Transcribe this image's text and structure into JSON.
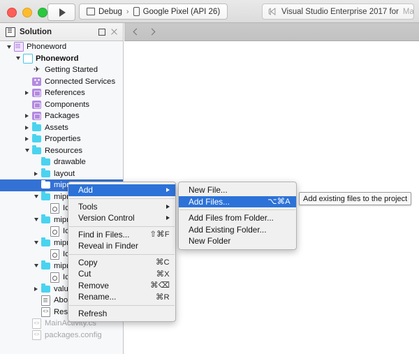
{
  "titlebar": {
    "window_controls": [
      "close",
      "minimize",
      "maximize"
    ],
    "run_button_label": "Run",
    "configuration": "Debug",
    "crumb_separator": "›",
    "device": "Google Pixel (API 26)",
    "status_main": "Visual Studio Enterprise 2017 for",
    "status_dim": "Mac"
  },
  "panel": {
    "title": "Solution",
    "pin_label": "Pin pad",
    "close_label": "Close pad"
  },
  "navbar": {
    "back_label": "Back",
    "forward_label": "Forward"
  },
  "tree": [
    {
      "label": "Phoneword",
      "indent": 0,
      "twisty": "down",
      "icon": "solution",
      "style": "normal"
    },
    {
      "label": "Phoneword",
      "indent": 1,
      "twisty": "down",
      "icon": "project",
      "style": "bold"
    },
    {
      "label": "Getting Started",
      "indent": 2,
      "twisty": "none",
      "icon": "rocket",
      "style": "normal"
    },
    {
      "label": "Connected Services",
      "indent": 2,
      "twisty": "none",
      "icon": "service",
      "style": "normal"
    },
    {
      "label": "References",
      "indent": 2,
      "twisty": "right",
      "icon": "package",
      "style": "normal"
    },
    {
      "label": "Components",
      "indent": 2,
      "twisty": "none",
      "icon": "package",
      "style": "normal"
    },
    {
      "label": "Packages",
      "indent": 2,
      "twisty": "right",
      "icon": "package",
      "style": "normal"
    },
    {
      "label": "Assets",
      "indent": 2,
      "twisty": "right",
      "icon": "folder",
      "style": "normal"
    },
    {
      "label": "Properties",
      "indent": 2,
      "twisty": "right",
      "icon": "folder",
      "style": "normal"
    },
    {
      "label": "Resources",
      "indent": 2,
      "twisty": "down",
      "icon": "folder",
      "style": "normal"
    },
    {
      "label": "drawable",
      "indent": 3,
      "twisty": "none",
      "icon": "folder",
      "style": "normal"
    },
    {
      "label": "layout",
      "indent": 3,
      "twisty": "right",
      "icon": "folder",
      "style": "normal"
    },
    {
      "label": "mipmap",
      "indent": 3,
      "twisty": "none",
      "icon": "folder",
      "style": "selected"
    },
    {
      "label": "mipmap",
      "indent": 3,
      "twisty": "down",
      "icon": "folder",
      "style": "normal"
    },
    {
      "label": "Icon.p",
      "indent": 4,
      "twisty": "none",
      "icon": "file-image",
      "style": "normal"
    },
    {
      "label": "mipmap",
      "indent": 3,
      "twisty": "down",
      "icon": "folder",
      "style": "normal"
    },
    {
      "label": "Icon.p",
      "indent": 4,
      "twisty": "none",
      "icon": "file-image",
      "style": "normal"
    },
    {
      "label": "mipmap",
      "indent": 3,
      "twisty": "down",
      "icon": "folder",
      "style": "normal"
    },
    {
      "label": "Icon.p",
      "indent": 4,
      "twisty": "none",
      "icon": "file-image",
      "style": "normal"
    },
    {
      "label": "mipmap",
      "indent": 3,
      "twisty": "down",
      "icon": "folder",
      "style": "normal"
    },
    {
      "label": "Icon.p",
      "indent": 4,
      "twisty": "none",
      "icon": "file-image",
      "style": "normal"
    },
    {
      "label": "values",
      "indent": 3,
      "twisty": "right",
      "icon": "folder",
      "style": "normal"
    },
    {
      "label": "AboutR",
      "indent": 3,
      "twisty": "none",
      "icon": "file-doc",
      "style": "normal"
    },
    {
      "label": "Resourc",
      "indent": 3,
      "twisty": "none",
      "icon": "file-code",
      "style": "normal"
    },
    {
      "label": "MainActivity.cs",
      "indent": 2,
      "twisty": "none",
      "icon": "file-code",
      "style": "dim"
    },
    {
      "label": "packages.config",
      "indent": 2,
      "twisty": "none",
      "icon": "file-code",
      "style": "dim"
    }
  ],
  "context_menu": {
    "items": [
      {
        "label": "Add",
        "shortcut": "",
        "submenu": true,
        "active": true
      },
      {
        "type": "separator"
      },
      {
        "label": "Tools",
        "shortcut": "",
        "submenu": true,
        "active": false
      },
      {
        "label": "Version Control",
        "shortcut": "",
        "submenu": true,
        "active": false
      },
      {
        "type": "separator"
      },
      {
        "label": "Find in Files...",
        "shortcut": "⇧⌘F",
        "submenu": false,
        "active": false
      },
      {
        "label": "Reveal in Finder",
        "shortcut": "",
        "submenu": false,
        "active": false
      },
      {
        "type": "separator"
      },
      {
        "label": "Copy",
        "shortcut": "⌘C",
        "submenu": false,
        "active": false
      },
      {
        "label": "Cut",
        "shortcut": "⌘X",
        "submenu": false,
        "active": false
      },
      {
        "label": "Remove",
        "shortcut": "⌘⌫",
        "submenu": false,
        "active": false
      },
      {
        "label": "Rename...",
        "shortcut": "⌘R",
        "submenu": false,
        "active": false
      },
      {
        "type": "separator"
      },
      {
        "label": "Refresh",
        "shortcut": "",
        "submenu": false,
        "active": false
      }
    ]
  },
  "submenu": {
    "items": [
      {
        "label": "New File...",
        "shortcut": "",
        "active": false
      },
      {
        "label": "Add Files...",
        "shortcut": "⌥⌘A",
        "active": true
      },
      {
        "type": "separator"
      },
      {
        "label": "Add Files from Folder...",
        "shortcut": "",
        "active": false
      },
      {
        "label": "Add Existing Folder...",
        "shortcut": "",
        "active": false
      },
      {
        "label": "New Folder",
        "shortcut": "",
        "active": false
      }
    ]
  },
  "tooltip": {
    "text": "Add existing files to the project"
  },
  "colors": {
    "selection_blue": "#3471d4",
    "menu_highlight": "#2c72d8",
    "folder_cyan": "#4ad3ef",
    "package_purple": "#b38ae0",
    "dim_text": "#a6a6ab"
  }
}
